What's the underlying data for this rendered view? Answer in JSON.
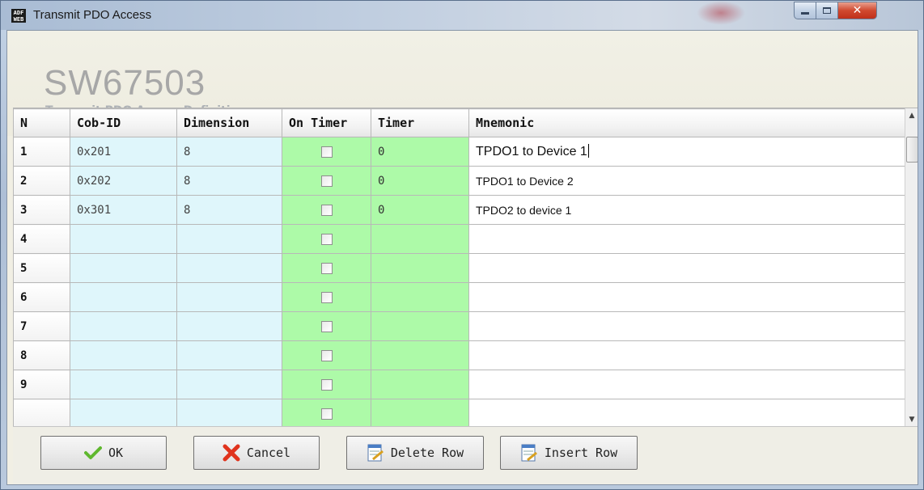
{
  "window": {
    "title": "Transmit PDO Access",
    "close_glyph": "✕"
  },
  "header": {
    "title": "SW67503",
    "subtitle": "Transmit PDO Access Definition"
  },
  "table": {
    "columns": [
      "N",
      "Cob-ID",
      "Dimension",
      "On Timer",
      "Timer",
      "Mnemonic"
    ],
    "rows": [
      {
        "n": "1",
        "cob_id": "0x201",
        "dimension": "8",
        "on_timer": false,
        "timer": "0",
        "mnemonic": "TPDO1 to Device 1"
      },
      {
        "n": "2",
        "cob_id": "0x202",
        "dimension": "8",
        "on_timer": false,
        "timer": "0",
        "mnemonic": "TPDO1 to Device 2"
      },
      {
        "n": "3",
        "cob_id": "0x301",
        "dimension": "8",
        "on_timer": false,
        "timer": "0",
        "mnemonic": "TPDO2 to device 1"
      },
      {
        "n": "4",
        "cob_id": "",
        "dimension": "",
        "on_timer": false,
        "timer": "",
        "mnemonic": ""
      },
      {
        "n": "5",
        "cob_id": "",
        "dimension": "",
        "on_timer": false,
        "timer": "",
        "mnemonic": ""
      },
      {
        "n": "6",
        "cob_id": "",
        "dimension": "",
        "on_timer": false,
        "timer": "",
        "mnemonic": ""
      },
      {
        "n": "7",
        "cob_id": "",
        "dimension": "",
        "on_timer": false,
        "timer": "",
        "mnemonic": ""
      },
      {
        "n": "8",
        "cob_id": "",
        "dimension": "",
        "on_timer": false,
        "timer": "",
        "mnemonic": ""
      },
      {
        "n": "9",
        "cob_id": "",
        "dimension": "",
        "on_timer": false,
        "timer": "",
        "mnemonic": ""
      }
    ]
  },
  "buttons": {
    "ok": "OK",
    "cancel": "Cancel",
    "delete_row": "Delete Row",
    "insert_row": "Insert Row"
  },
  "icons": {
    "app": "adfweb-app-icon",
    "ok": "green-checkmark-icon",
    "cancel": "red-x-icon",
    "delete_row": "delete-row-icon",
    "insert_row": "insert-row-icon"
  },
  "colors": {
    "cyan_cell": "#dff6fb",
    "green_cell": "#adfaa8",
    "title_gray": "#a7a7a7"
  }
}
